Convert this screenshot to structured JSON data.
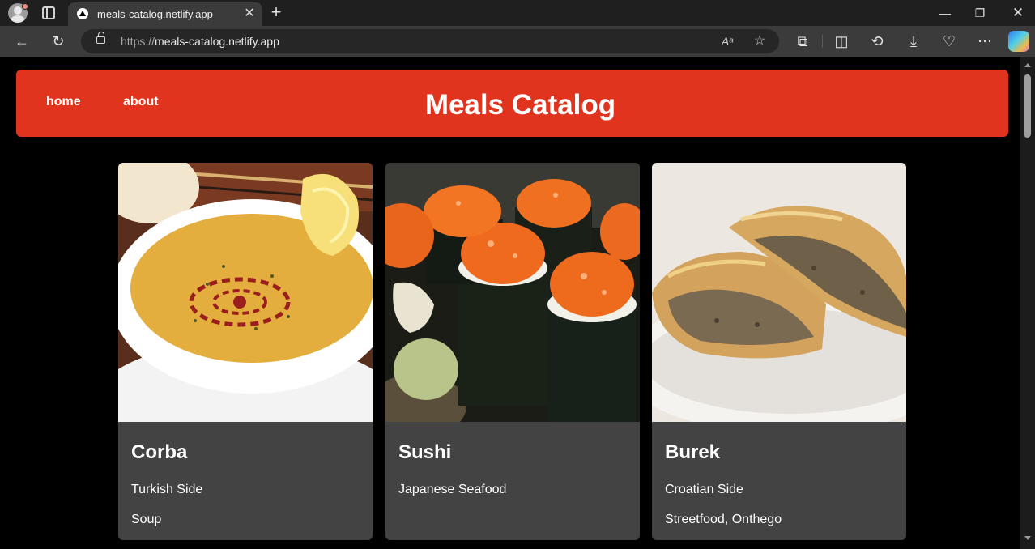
{
  "browser": {
    "tab_title": "meals-catalog.netlify.app",
    "url_scheme": "https://",
    "url_host": "meals-catalog.netlify.app"
  },
  "site": {
    "title": "Meals Catalog",
    "nav": [
      "home",
      "about"
    ],
    "header_color": "#e0341f"
  },
  "meals": [
    {
      "name": "Corba",
      "area": "Turkish",
      "category": "Side",
      "tags": "Soup"
    },
    {
      "name": "Sushi",
      "area": "Japanese",
      "category": "Seafood",
      "tags": ""
    },
    {
      "name": "Burek",
      "area": "Croatian",
      "category": "Side",
      "tags": "Streetfood, Onthego"
    }
  ],
  "meal_lines": [
    "Turkish Side",
    "Japanese Seafood",
    "Croatian Side"
  ]
}
